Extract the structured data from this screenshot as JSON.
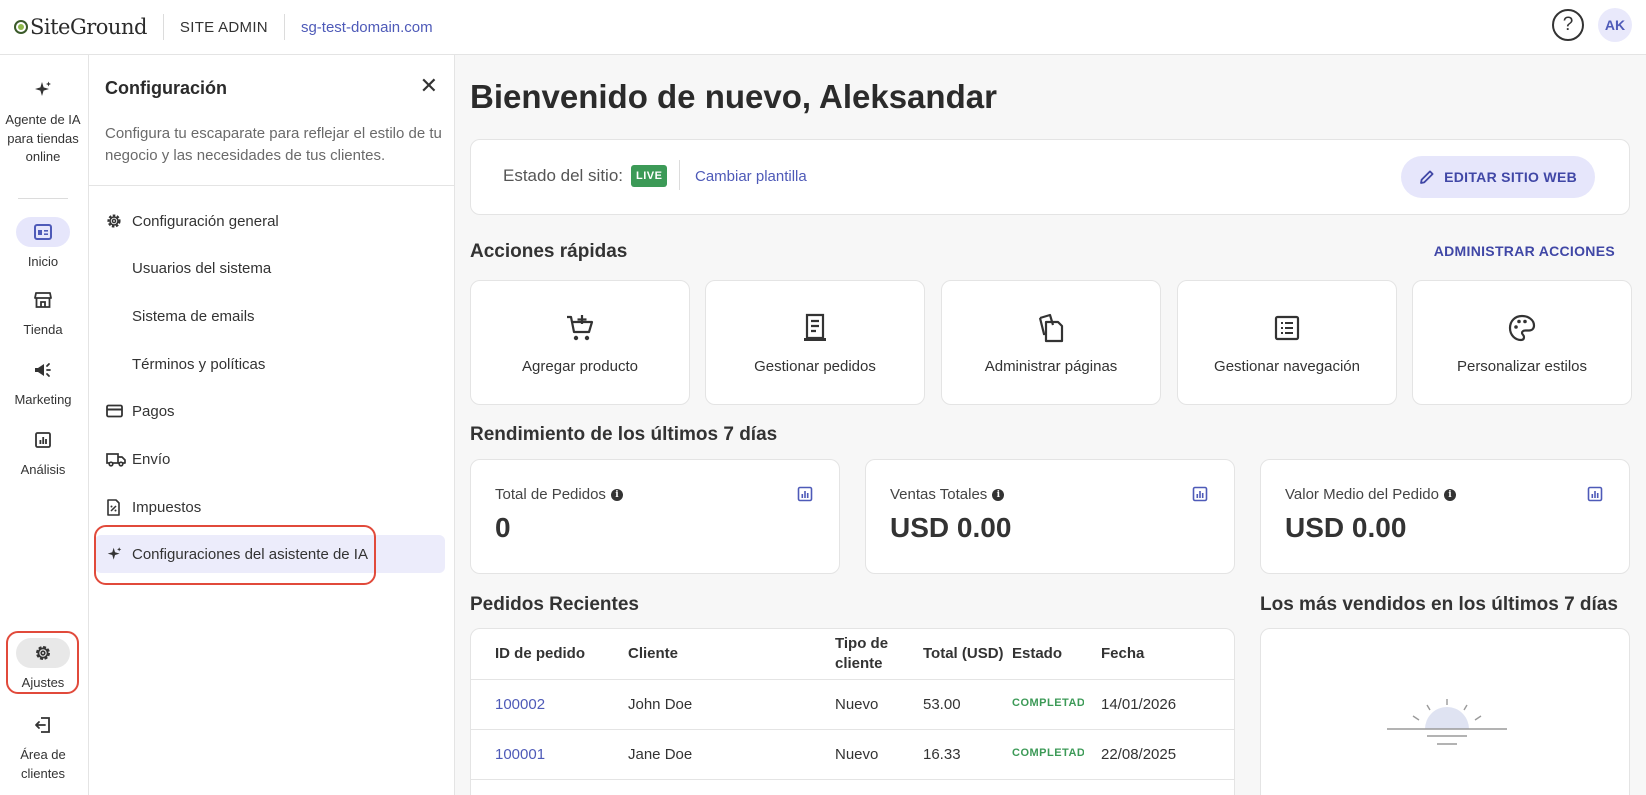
{
  "topbar": {
    "logo": "SiteGround",
    "site_admin": "SITE ADMIN",
    "domain": "sg-test-domain.com",
    "help": "?",
    "avatar": "AK"
  },
  "rail": {
    "ai_agent": "Agente de IA para tiendas online",
    "home": "Inicio",
    "store": "Tienda",
    "marketing": "Marketing",
    "analytics": "Análisis",
    "settings": "Ajustes",
    "client_area": "Área de clientes"
  },
  "panel": {
    "title": "Configuración",
    "description": "Configura tu escaparate para reflejar el estilo de tu negocio y las necesidades de tus clientes.",
    "items": [
      {
        "label": "Configuración general",
        "icon": "gear-icon"
      },
      {
        "label": "Usuarios del sistema"
      },
      {
        "label": "Sistema de emails"
      },
      {
        "label": "Términos y políticas"
      },
      {
        "label": "Pagos",
        "icon": "credit-card-icon"
      },
      {
        "label": "Envío",
        "icon": "truck-icon"
      },
      {
        "label": "Impuestos",
        "icon": "tax-document-icon"
      },
      {
        "label": "Configuraciones del asistente de IA",
        "icon": "sparkle-icon"
      }
    ]
  },
  "main": {
    "welcome": "Bienvenido de nuevo, Aleksandar",
    "status": {
      "label": "Estado del sitio:",
      "badge": "LIVE",
      "change_template": "Cambiar plantilla",
      "edit_button": "EDITAR SITIO WEB"
    },
    "quick_actions": {
      "title": "Acciones rápidas",
      "manage": "ADMINISTRAR ACCIONES",
      "items": [
        {
          "label": "Agregar producto",
          "icon": "add-to-cart-icon"
        },
        {
          "label": "Gestionar pedidos",
          "icon": "receipt-icon"
        },
        {
          "label": "Administrar páginas",
          "icon": "pages-icon"
        },
        {
          "label": "Gestionar navegación",
          "icon": "list-icon"
        },
        {
          "label": "Personalizar estilos",
          "icon": "palette-icon"
        }
      ]
    },
    "performance": {
      "title": "Rendimiento de los últimos 7 días",
      "stats": [
        {
          "label": "Total de Pedidos",
          "value": "0"
        },
        {
          "label": "Ventas Totales",
          "value": "USD 0.00"
        },
        {
          "label": "Valor Medio del Pedido",
          "value": "USD 0.00"
        }
      ]
    },
    "orders": {
      "title": "Pedidos Recientes",
      "columns": [
        "ID de pedido",
        "Cliente",
        "Tipo de cliente",
        "Total (USD)",
        "Estado",
        "Fecha"
      ],
      "rows": [
        {
          "id": "100002",
          "customer": "John Doe",
          "type": "Nuevo",
          "total": "53.00",
          "status": "COMPLETADO",
          "date": "14/01/2026"
        },
        {
          "id": "100001",
          "customer": "Jane Doe",
          "type": "Nuevo",
          "total": "16.33",
          "status": "COMPLETADO",
          "date": "22/08/2025"
        }
      ]
    },
    "best_sellers": {
      "title": "Los más vendidos en los últimos 7 días"
    }
  },
  "colors": {
    "accent": "#4e5ab8",
    "accent_bg": "#e6e6fb",
    "live_green": "#3c9a57",
    "highlight_red": "#e14a3b"
  }
}
